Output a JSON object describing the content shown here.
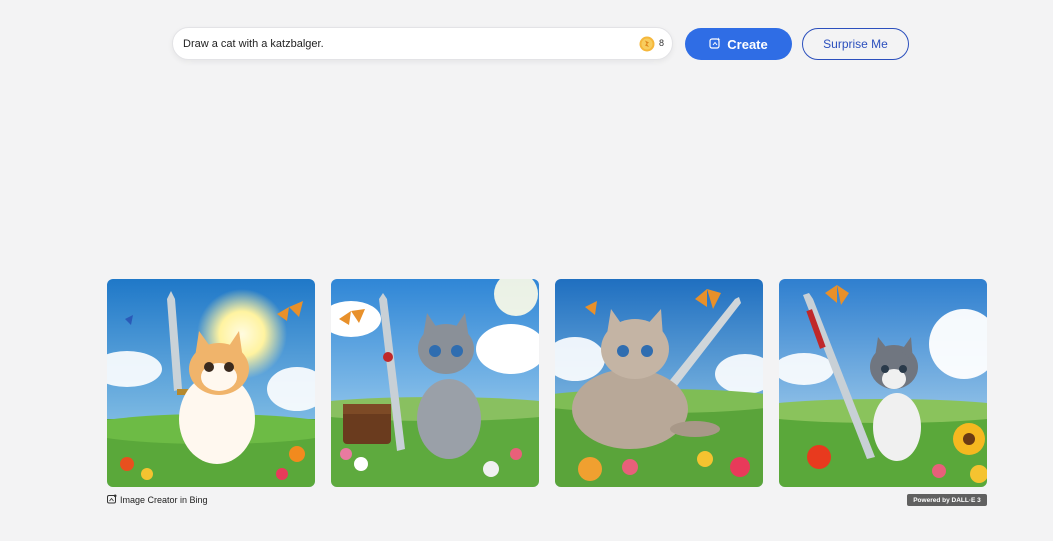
{
  "prompt": {
    "value": "Draw a cat with a katzbalger.",
    "coin_icon": "coin-icon",
    "boosts": "8"
  },
  "buttons": {
    "create_label": "Create",
    "surprise_label": "Surprise Me"
  },
  "results": {
    "images": [
      {
        "name": "result-image-1",
        "subject": "orange-white kitten holding sword, sun, butterflies, flowers"
      },
      {
        "name": "result-image-2",
        "subject": "grey tabby kitten beside sword and leather bag"
      },
      {
        "name": "result-image-3",
        "subject": "fluffy grey cat lying with sword in meadow"
      },
      {
        "name": "result-image-4",
        "subject": "grey-white cat sitting by tall sword, sunflowers"
      }
    ]
  },
  "footer": {
    "credit": "Image Creator in Bing",
    "badge": "Powered by DALL·E 3"
  },
  "colors": {
    "accent": "#2f6de5",
    "outline": "#2b4fbd",
    "background": "#f3f3f4"
  }
}
